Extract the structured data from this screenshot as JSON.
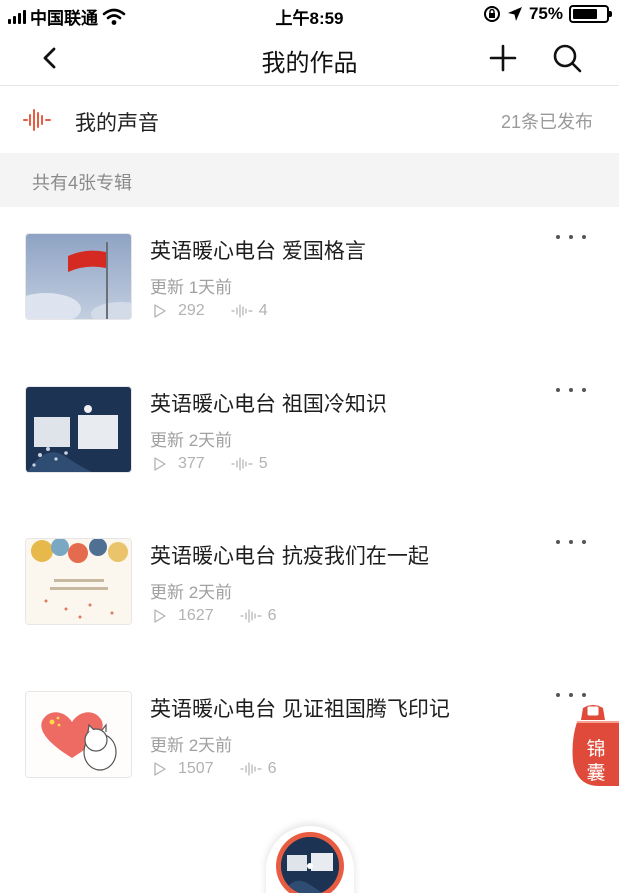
{
  "status_bar": {
    "carrier": "中国联通",
    "time": "上午8:59",
    "battery": "75%",
    "battery_level": 0.75
  },
  "nav": {
    "title": "我的作品",
    "icons": {
      "back": "chevron-left-icon",
      "add": "plus-icon",
      "search": "search-icon"
    }
  },
  "my_voice": {
    "label": "我的声音",
    "count": "21条已发布",
    "icon": "sound-wave-icon",
    "accent": "#e85d42"
  },
  "albums_header": "共有4张专辑",
  "albums": [
    {
      "title": "英语暖心电台 爱国格言",
      "updated": "更新 1天前",
      "plays": "292",
      "tracks": "4"
    },
    {
      "title": "英语暖心电台 祖国冷知识",
      "updated": "更新 2天前",
      "plays": "377",
      "tracks": "5"
    },
    {
      "title": "英语暖心电台 抗疫我们在一起",
      "updated": "更新 2天前",
      "plays": "1627",
      "tracks": "6"
    },
    {
      "title": "英语暖心电台 见证祖国腾飞印记",
      "updated": "更新 2天前",
      "plays": "1507",
      "tracks": "6"
    }
  ],
  "floating": {
    "jinnang_line1": "锦",
    "jinnang_line2": "囊"
  },
  "colors": {
    "accent": "#e85d42",
    "muted_text": "#a0a0a0",
    "section_bg": "#f4f4f4"
  }
}
